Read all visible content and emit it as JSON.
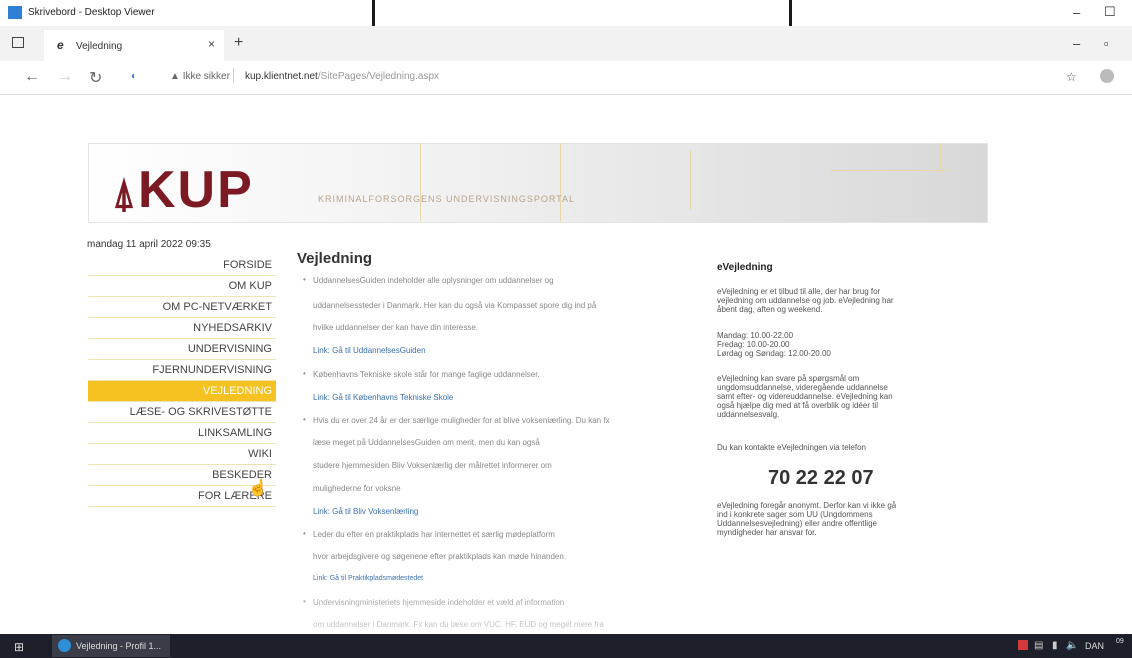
{
  "outer": {
    "title": "Skrivebord - Desktop Viewer",
    "remote_tab": "...... ▾ ......"
  },
  "browser": {
    "tab_title": "Vejledning",
    "insecure_label": "Ikke sikker",
    "url_host": "kup.klientnet.net",
    "url_path": "/SitePages/Vejledning.aspx"
  },
  "site": {
    "logo": "KUP",
    "subtitle": "KRIMINALFORSORGENS UNDERVISNINGSPORTAL",
    "date": "mandag 11 april 2022 09:35",
    "nav": [
      "FORSIDE",
      "OM KUP",
      "OM PC-NETVÆRKET",
      "NYHEDSARKIV",
      "UNDERVISNING",
      "FJERNUNDERVISNING",
      "VEJLEDNING",
      "LÆSE- OG SKRIVESTØTTE",
      "LINKSAMLING",
      "WIKI",
      "BESKEDER",
      "FOR LÆRERE"
    ]
  },
  "main": {
    "title": "Vejledning",
    "lines": [
      "UddannelsesGuiden indeholder alle oplysninger om uddannelser og",
      "uddannelsessteder i Danmark. Her kan du også via Kompasset spore dig ind på",
      "hvilke uddannelser der kan have din interesse.",
      "Link: Gå til UddannelsesGuiden",
      "Københavns Tekniske skole står for mange faglige uddannelser.",
      "Link: Gå til Københavns Tekniske Skole",
      "Hvis du er over 24 år er der særlige muligheder for at blive voksenlærling. Du kan fx",
      "læse meget på UddannelsesGuiden om merit, men du kan også",
      "studere hjemmesiden Bliv Voksenlærlig der målrettet informerer om",
      "mulighederne for voksne",
      "Link: Gå til Bliv Voksenlærling",
      "Leder du efter en praktikplads har internettet et særlig mødeplatform",
      "hvor arbejdsgivere og søgenene efter praktikplads kan møde hinanden.",
      "Link: Gå til Praktikpladsmødestedet",
      "Undervisningministeriets hjemmeside indeholder et væld af information",
      "om uddannelser i Danmark. Fx kan du læse om VUC, HF, EUD og meget mere fra"
    ]
  },
  "evejledning": {
    "title": "eVejledning",
    "p1": [
      "eVejledning er et tilbud til alle, der har brug for",
      "vejledning om uddannelse og job. eVejledning har",
      "åbent dag, aften og weekend."
    ],
    "hours": [
      "Mandag: 10.00-22.00",
      "Fredag: 10.00-20.00",
      "Lørdag og Søndag: 12.00-20.00"
    ],
    "p2": [
      "eVejledning kan svare på spørgsmål om",
      "ungdomsuddannelse, videregående uddannelse",
      "samt efter- og videreuddannelse. eVejledning kan",
      "også hjælpe dig med at få overblik og idéer til",
      "uddannelsesvalg."
    ],
    "contact": "Du kan kontakte eVejledningen via telefon",
    "phone": "70 22 22 07",
    "p3": [
      "eVejledning foregår anonymt. Derfor kan vi ikke gå",
      "ind i konkrete sager som UU (Ungdommens",
      "Uddannelsesvejledning) eller andre offentlige",
      "myndigheder har ansvar for."
    ]
  },
  "taskbar": {
    "item": "Vejledning - Profil 1...",
    "lang": "DAN",
    "clock": "09"
  }
}
